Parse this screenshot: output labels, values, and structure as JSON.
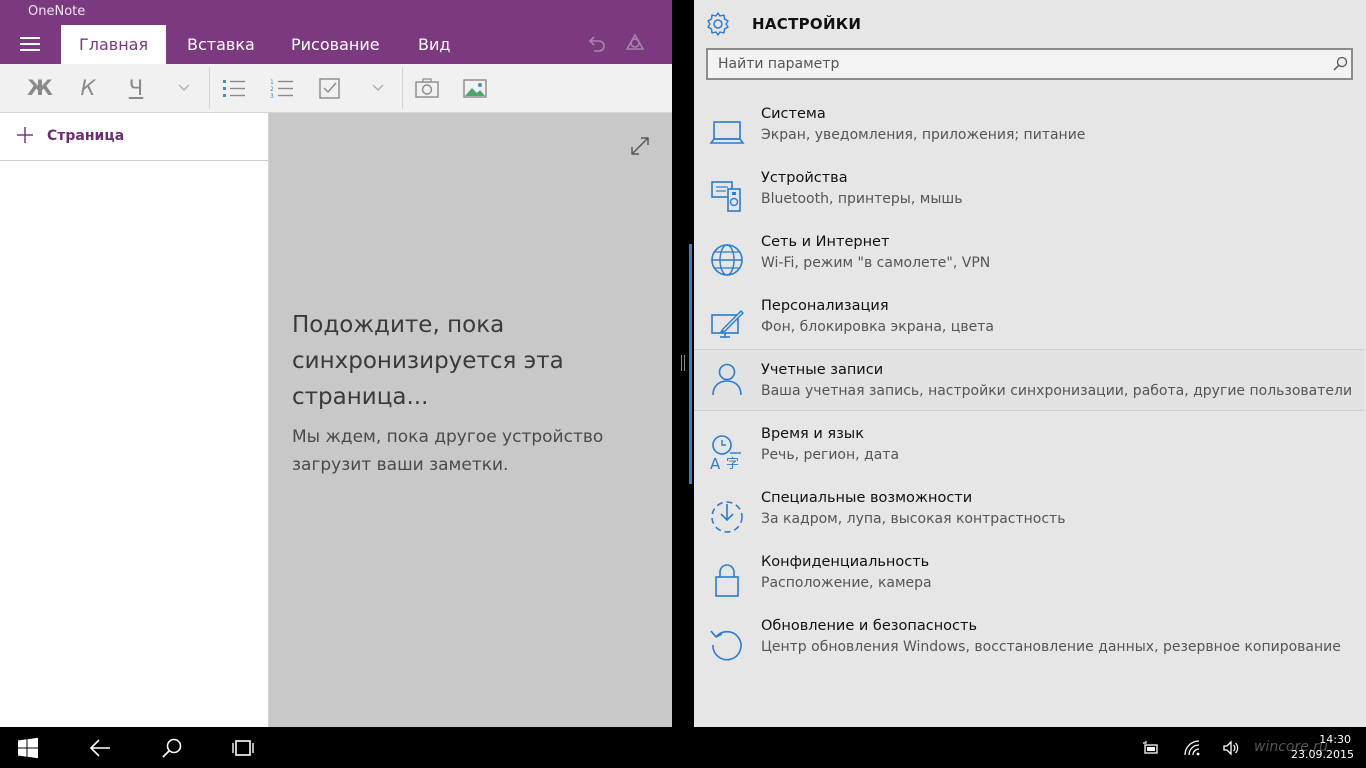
{
  "onenote": {
    "app_title": "OneNote",
    "tabs": [
      {
        "label": "Главная"
      },
      {
        "label": "Вставка"
      },
      {
        "label": "Рисование"
      },
      {
        "label": "Вид"
      }
    ],
    "format_buttons": {
      "bold": "Ж",
      "italic": "К",
      "underline": "Ч"
    },
    "add_page_label": "Страница",
    "sync_title": "Подождите, пока синхронизируется эта страница...",
    "sync_subtitle": "Мы ждем, пока другое устройство загрузит ваши заметки.",
    "accent_color": "#7b3a80"
  },
  "settings": {
    "title": "НАСТРОЙКИ",
    "search_placeholder": "Найти параметр",
    "items": [
      {
        "name": "Система",
        "desc": "Экран, уведомления, приложения; питание",
        "icon": "laptop-icon"
      },
      {
        "name": "Устройства",
        "desc": "Bluetooth, принтеры, мышь",
        "icon": "devices-icon"
      },
      {
        "name": "Сеть и Интернет",
        "desc": "Wi-Fi, режим \"в самолете\", VPN",
        "icon": "globe-icon"
      },
      {
        "name": "Персонализация",
        "desc": "Фон, блокировка экрана, цвета",
        "icon": "personalization-icon"
      },
      {
        "name": "Учетные записи",
        "desc": "Ваша учетная запись, настройки синхронизации, работа, другие пользователи",
        "icon": "person-icon"
      },
      {
        "name": "Время и язык",
        "desc": "Речь, регион, дата",
        "icon": "time-language-icon"
      },
      {
        "name": "Специальные возможности",
        "desc": "За кадром, лупа, высокая контрастность",
        "icon": "ease-of-access-icon"
      },
      {
        "name": "Конфиденциальность",
        "desc": "Расположение, камера",
        "icon": "lock-icon"
      },
      {
        "name": "Обновление и безопасность",
        "desc": "Центр обновления Windows, восстановление данных, резервное копирование",
        "icon": "update-icon"
      }
    ],
    "accent_color": "#2b7cd3"
  },
  "taskbar": {
    "time": "14:30",
    "date": "23.09.2015",
    "watermark": "wincore.ru"
  }
}
